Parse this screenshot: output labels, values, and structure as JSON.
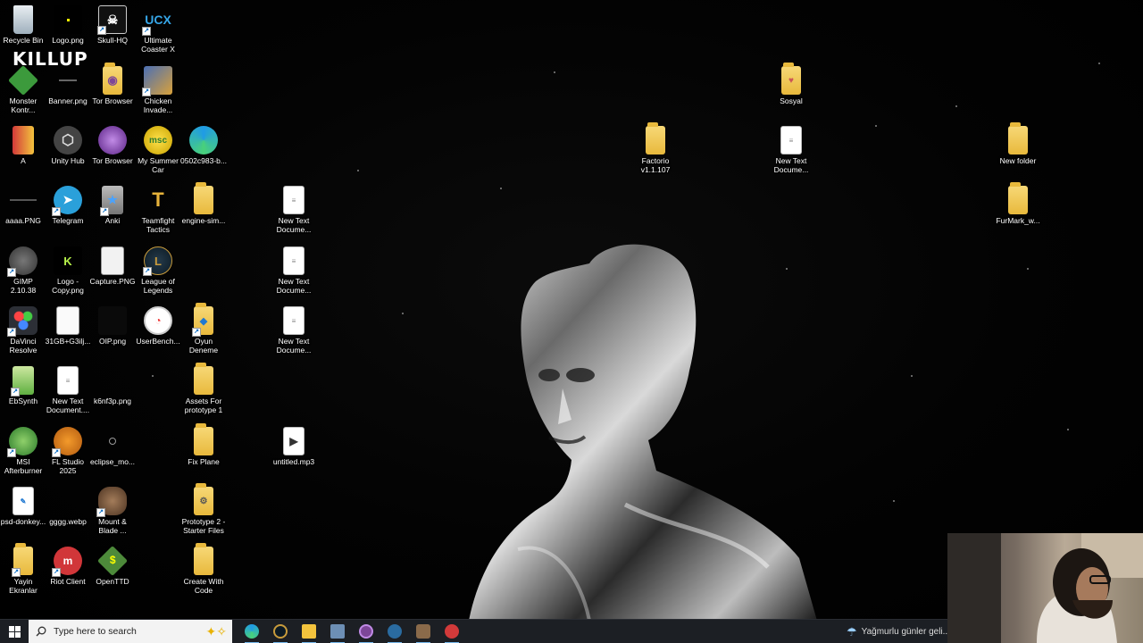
{
  "desktop": {
    "overlay_text": "KILLUP",
    "icons": [
      {
        "label": "Recycle Bin"
      },
      {
        "label": "Logo.png"
      },
      {
        "label": "Skull-HQ"
      },
      {
        "label": "Ultimate Coaster X"
      },
      {
        "label": "Monster Kontr..."
      },
      {
        "label": "Banner.png"
      },
      {
        "label": "Tor Browser"
      },
      {
        "label": "Chicken Invade..."
      },
      {
        "label": "A"
      },
      {
        "label": "Unity Hub"
      },
      {
        "label": "Tor Browser"
      },
      {
        "label": "My Summer Car"
      },
      {
        "label": "0502c983-b..."
      },
      {
        "label": "aaaa.PNG"
      },
      {
        "label": "Telegram"
      },
      {
        "label": "Anki"
      },
      {
        "label": "Teamfight Tactics"
      },
      {
        "label": "engine-sim..."
      },
      {
        "label": "New Text Docume..."
      },
      {
        "label": "GIMP 2.10.38"
      },
      {
        "label": "Logo - Copy.png"
      },
      {
        "label": "Capture.PNG"
      },
      {
        "label": "League of Legends"
      },
      {
        "label": "New Text Docume..."
      },
      {
        "label": "DaVinci Resolve"
      },
      {
        "label": "31GB+G3ilj..."
      },
      {
        "label": "OIP.png"
      },
      {
        "label": "UserBench..."
      },
      {
        "label": "Oyun Deneme"
      },
      {
        "label": "New Text Docume..."
      },
      {
        "label": "EbSynth"
      },
      {
        "label": "New Text Document...."
      },
      {
        "label": "k6nf3p.png"
      },
      {
        "label": "Assets For prototype 1"
      },
      {
        "label": "MSI Afterburner"
      },
      {
        "label": "FL Studio 2025"
      },
      {
        "label": "eclipse_mo..."
      },
      {
        "label": "Fix Plane"
      },
      {
        "label": "untitled.mp3"
      },
      {
        "label": "psd-donkey..."
      },
      {
        "label": "gggg.webp"
      },
      {
        "label": "Mount & Blade ..."
      },
      {
        "label": "Prototype 2 - Starter Files"
      },
      {
        "label": "Yayin Ekranlar"
      },
      {
        "label": "Riot Client"
      },
      {
        "label": "OpenTTD"
      },
      {
        "label": "Create With Code"
      },
      {
        "label": "Sosyal"
      },
      {
        "label": "Factorio v1.1.107"
      },
      {
        "label": "New Text Docume..."
      },
      {
        "label": "New folder"
      },
      {
        "label": "FurMark_w..."
      }
    ]
  },
  "taskbar": {
    "search_placeholder": "Type here to search",
    "weather_text": "Yağmurlu günler geli...",
    "pinned": [
      {
        "name": "edge-icon",
        "color": "#1f9be6"
      },
      {
        "name": "league-icon",
        "color": "#c89b3c"
      },
      {
        "name": "file-explorer-icon",
        "color": "#f3c33d"
      },
      {
        "name": "photos-icon",
        "color": "#6d8fb5"
      },
      {
        "name": "tor-icon",
        "color": "#7d4698"
      },
      {
        "name": "steam-icon",
        "color": "#2a6ba0"
      },
      {
        "name": "mount-blade-icon",
        "color": "#8a6a4a"
      },
      {
        "name": "app-red-icon",
        "color": "#d23a3a"
      }
    ]
  }
}
